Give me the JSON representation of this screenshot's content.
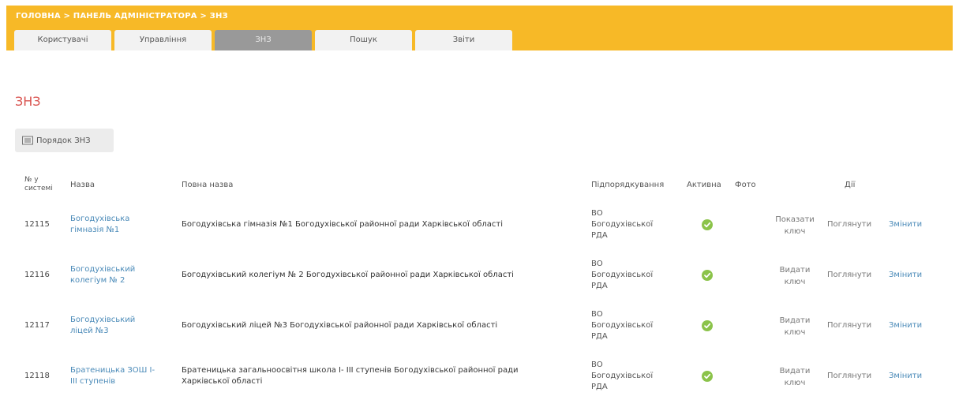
{
  "breadcrumb": "ГОЛОВНА > ПАНЕЛЬ АДМІНІСТРАТОРА > ЗНЗ",
  "tabs": [
    "Користувачі",
    "Управління",
    "ЗНЗ",
    "Пошук",
    "Звіти"
  ],
  "active_tab": "ЗНЗ",
  "page_title": "ЗНЗ",
  "order_button": "Порядок ЗНЗ",
  "columns": {
    "id": [
      "№ у",
      "системі"
    ],
    "name": "Назва",
    "full_name": "Повна назва",
    "subordination": "Підпорядкування",
    "active": "Активна",
    "photo": "Фото",
    "actions": "Дії"
  },
  "rows": [
    {
      "id": "12115",
      "name": [
        "Богодухівська",
        "гімназія №1"
      ],
      "full_name": [
        "Богодухівська гімназія №1 Богодухівської районної ради Харківської області"
      ],
      "subordination": [
        "ВО",
        "Богодухівської",
        "РДА"
      ],
      "active": true,
      "key_action": [
        "Показати",
        "ключ"
      ],
      "view": "Поглянути",
      "edit": "Змінити"
    },
    {
      "id": "12116",
      "name": [
        "Богодухівський",
        "колегіум № 2"
      ],
      "full_name": [
        "Богодухівський колегіум № 2 Богодухівської районної ради Харківської області"
      ],
      "subordination": [
        "ВО",
        "Богодухівської",
        "РДА"
      ],
      "active": true,
      "key_action": [
        "Видати",
        "ключ"
      ],
      "view": "Поглянути",
      "edit": "Змінити"
    },
    {
      "id": "12117",
      "name": [
        "Богодухівський",
        "ліцей №3"
      ],
      "full_name": [
        "Богодухівський ліцей №3 Богодухівської районної ради Харківської області"
      ],
      "subordination": [
        "ВО",
        "Богодухівської",
        "РДА"
      ],
      "active": true,
      "key_action": [
        "Видати",
        "ключ"
      ],
      "view": "Поглянути",
      "edit": "Змінити"
    },
    {
      "id": "12118",
      "name": [
        "Братеницька ЗОШ І-",
        "ІІІ ступенів"
      ],
      "full_name": [
        "Братеницька загальноосвітня школа І- ІІІ ступенів Богодухівської районної ради",
        "Харківської області"
      ],
      "subordination": [
        "ВО",
        "Богодухівської",
        "РДА"
      ],
      "active": true,
      "key_action": [
        "Видати",
        "ключ"
      ],
      "view": "Поглянути",
      "edit": "Змінити"
    }
  ]
}
